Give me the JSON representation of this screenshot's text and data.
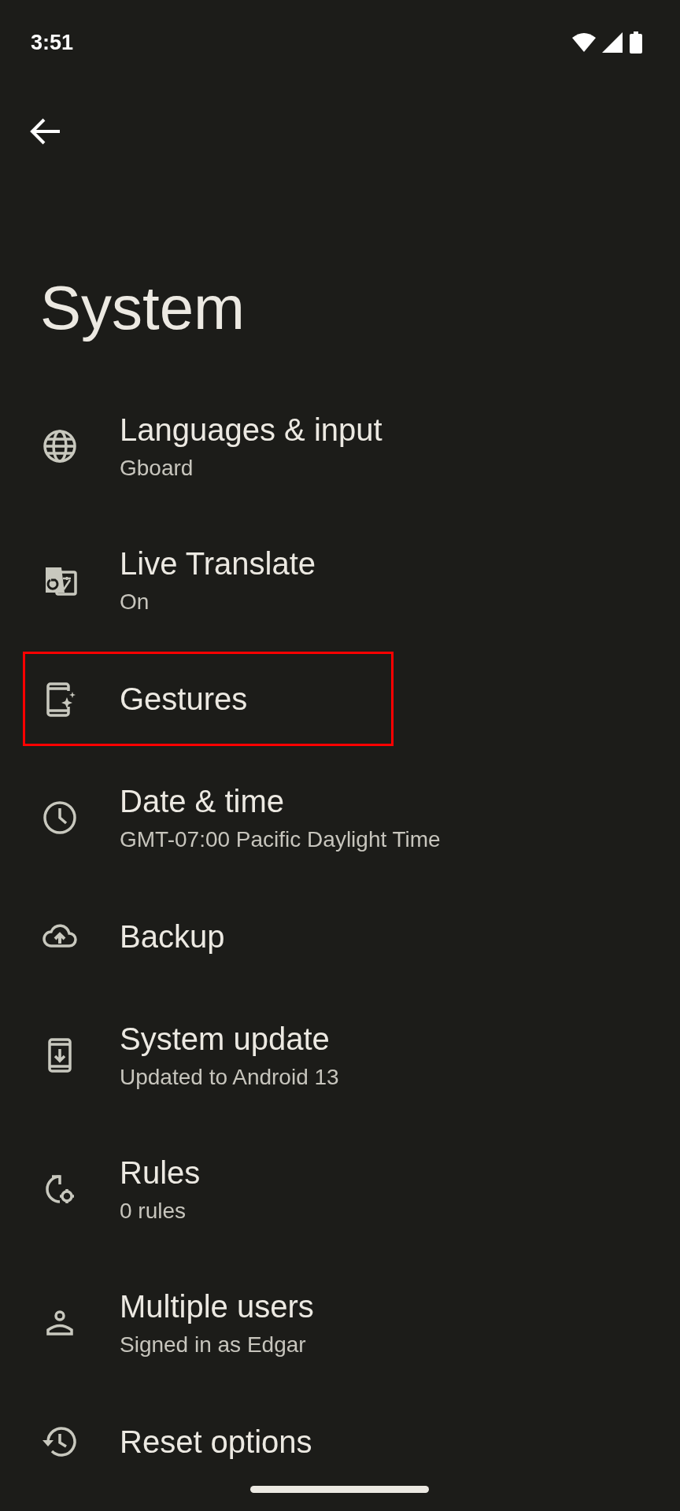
{
  "status_bar": {
    "time": "3:51"
  },
  "title": "System",
  "items": [
    {
      "title": "Languages & input",
      "subtitle": "Gboard",
      "highlighted": false
    },
    {
      "title": "Live Translate",
      "subtitle": "On",
      "highlighted": false
    },
    {
      "title": "Gestures",
      "highlighted": true
    },
    {
      "title": "Date & time",
      "subtitle": "GMT-07:00 Pacific Daylight Time",
      "highlighted": false
    },
    {
      "title": "Backup",
      "highlighted": false
    },
    {
      "title": "System update",
      "subtitle": "Updated to Android 13",
      "highlighted": false
    },
    {
      "title": "Rules",
      "subtitle": "0 rules",
      "highlighted": false
    },
    {
      "title": "Multiple users",
      "subtitle": "Signed in as Edgar",
      "highlighted": false
    },
    {
      "title": "Reset options",
      "highlighted": false
    }
  ]
}
